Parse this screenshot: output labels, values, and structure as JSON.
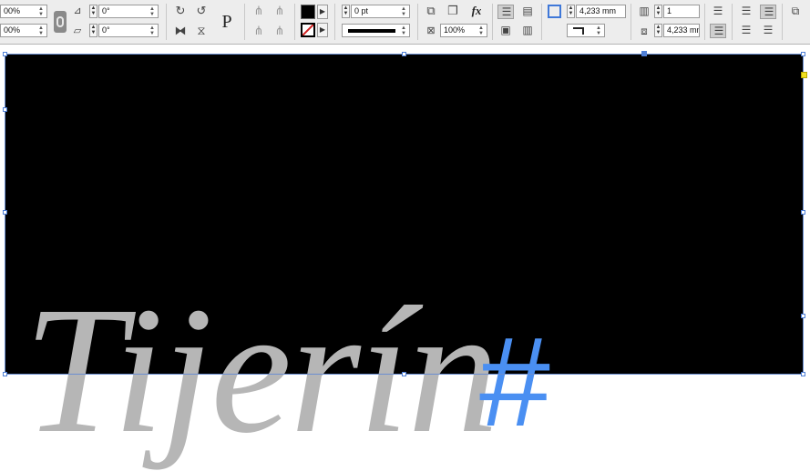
{
  "toolbar": {
    "scale_x": "00%",
    "scale_y": "00%",
    "rotation_angle": "0°",
    "shear_angle": "0°",
    "text_frame_glyph": "P",
    "stroke_weight": "0 pt",
    "opacity": "100%",
    "fx_label": "fx",
    "column_gutter": "4,233 mm",
    "frame_gutter": "4,233 mm",
    "columns": "1"
  },
  "document": {
    "text": "Tijerín",
    "hash": "#",
    "colors": {
      "frame_fill": "#000000",
      "text": "#b6b6b6",
      "hash": "#4a8ff2",
      "selection": "#4f7fd6"
    }
  }
}
